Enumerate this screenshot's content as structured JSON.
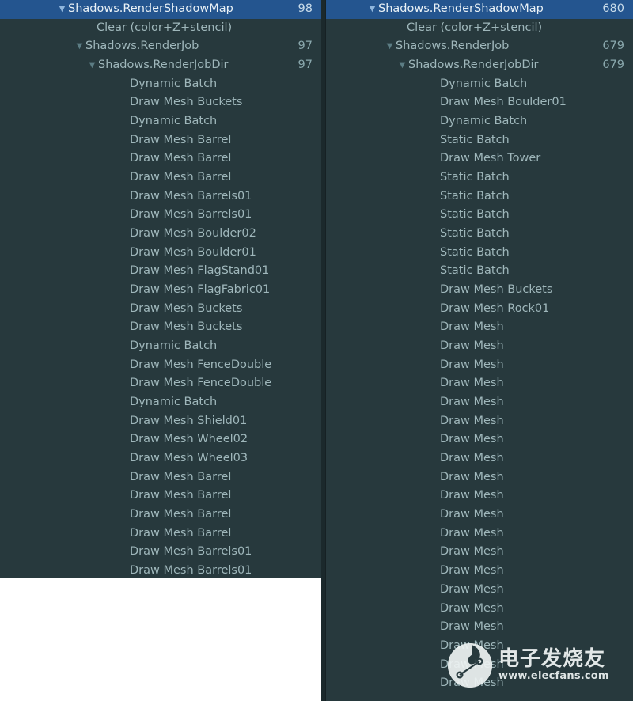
{
  "colors": {
    "panel_background": "#27393d",
    "selection": "#24558f",
    "row_text": "#9fb7bb",
    "selected_text": "#e9f1f6",
    "value_text": "#8aa8ad",
    "divider": "#1b292c",
    "page_background": "#ffffff"
  },
  "left_panel": {
    "name": "profiler-hierarchy-left",
    "rows": [
      {
        "label": "Shadows.RenderShadowMap",
        "value": "98",
        "depth": 0,
        "arrow": "▼",
        "selected": true
      },
      {
        "label": "Clear (color+Z+stencil)",
        "value": "",
        "depth": 1,
        "arrow": "",
        "selected": false
      },
      {
        "label": "Shadows.RenderJob",
        "value": "97",
        "depth": 2,
        "arrow": "▼",
        "selected": false
      },
      {
        "label": "Shadows.RenderJobDir",
        "value": "97",
        "depth": 3,
        "arrow": "▼",
        "selected": false
      },
      {
        "label": "Dynamic Batch",
        "value": "",
        "depth": 4,
        "arrow": "",
        "selected": false
      },
      {
        "label": "Draw Mesh Buckets",
        "value": "",
        "depth": 4,
        "arrow": "",
        "selected": false
      },
      {
        "label": "Dynamic Batch",
        "value": "",
        "depth": 4,
        "arrow": "",
        "selected": false
      },
      {
        "label": "Draw Mesh Barrel",
        "value": "",
        "depth": 4,
        "arrow": "",
        "selected": false
      },
      {
        "label": "Draw Mesh Barrel",
        "value": "",
        "depth": 4,
        "arrow": "",
        "selected": false
      },
      {
        "label": "Draw Mesh Barrel",
        "value": "",
        "depth": 4,
        "arrow": "",
        "selected": false
      },
      {
        "label": "Draw Mesh Barrels01",
        "value": "",
        "depth": 4,
        "arrow": "",
        "selected": false
      },
      {
        "label": "Draw Mesh Barrels01",
        "value": "",
        "depth": 4,
        "arrow": "",
        "selected": false
      },
      {
        "label": "Draw Mesh Boulder02",
        "value": "",
        "depth": 4,
        "arrow": "",
        "selected": false
      },
      {
        "label": "Draw Mesh Boulder01",
        "value": "",
        "depth": 4,
        "arrow": "",
        "selected": false
      },
      {
        "label": "Draw Mesh FlagStand01",
        "value": "",
        "depth": 4,
        "arrow": "",
        "selected": false
      },
      {
        "label": "Draw Mesh FlagFabric01",
        "value": "",
        "depth": 4,
        "arrow": "",
        "selected": false
      },
      {
        "label": "Draw Mesh Buckets",
        "value": "",
        "depth": 4,
        "arrow": "",
        "selected": false
      },
      {
        "label": "Draw Mesh Buckets",
        "value": "",
        "depth": 4,
        "arrow": "",
        "selected": false
      },
      {
        "label": "Dynamic Batch",
        "value": "",
        "depth": 4,
        "arrow": "",
        "selected": false
      },
      {
        "label": "Draw Mesh FenceDouble",
        "value": "",
        "depth": 4,
        "arrow": "",
        "selected": false
      },
      {
        "label": "Draw Mesh FenceDouble",
        "value": "",
        "depth": 4,
        "arrow": "",
        "selected": false
      },
      {
        "label": "Dynamic Batch",
        "value": "",
        "depth": 4,
        "arrow": "",
        "selected": false
      },
      {
        "label": "Draw Mesh Shield01",
        "value": "",
        "depth": 4,
        "arrow": "",
        "selected": false
      },
      {
        "label": "Draw Mesh Wheel02",
        "value": "",
        "depth": 4,
        "arrow": "",
        "selected": false
      },
      {
        "label": "Draw Mesh Wheel03",
        "value": "",
        "depth": 4,
        "arrow": "",
        "selected": false
      },
      {
        "label": "Draw Mesh Barrel",
        "value": "",
        "depth": 4,
        "arrow": "",
        "selected": false
      },
      {
        "label": "Draw Mesh Barrel",
        "value": "",
        "depth": 4,
        "arrow": "",
        "selected": false
      },
      {
        "label": "Draw Mesh Barrel",
        "value": "",
        "depth": 4,
        "arrow": "",
        "selected": false
      },
      {
        "label": "Draw Mesh Barrel",
        "value": "",
        "depth": 4,
        "arrow": "",
        "selected": false
      },
      {
        "label": "Draw Mesh Barrels01",
        "value": "",
        "depth": 4,
        "arrow": "",
        "selected": false
      },
      {
        "label": "Draw Mesh Barrels01",
        "value": "",
        "depth": 4,
        "arrow": "",
        "selected": false
      }
    ]
  },
  "right_panel": {
    "name": "profiler-hierarchy-right",
    "rows": [
      {
        "label": "Shadows.RenderShadowMap",
        "value": "680",
        "depth": 0,
        "arrow": "▼",
        "selected": true
      },
      {
        "label": "Clear (color+Z+stencil)",
        "value": "",
        "depth": 1,
        "arrow": "",
        "selected": false
      },
      {
        "label": "Shadows.RenderJob",
        "value": "679",
        "depth": 2,
        "arrow": "▼",
        "selected": false
      },
      {
        "label": "Shadows.RenderJobDir",
        "value": "679",
        "depth": 3,
        "arrow": "▼",
        "selected": false
      },
      {
        "label": "Dynamic Batch",
        "value": "",
        "depth": 4,
        "arrow": "",
        "selected": false
      },
      {
        "label": "Draw Mesh Boulder01",
        "value": "",
        "depth": 4,
        "arrow": "",
        "selected": false
      },
      {
        "label": "Dynamic Batch",
        "value": "",
        "depth": 4,
        "arrow": "",
        "selected": false
      },
      {
        "label": "Static Batch",
        "value": "",
        "depth": 4,
        "arrow": "",
        "selected": false
      },
      {
        "label": "Draw Mesh Tower",
        "value": "",
        "depth": 4,
        "arrow": "",
        "selected": false
      },
      {
        "label": "Static Batch",
        "value": "",
        "depth": 4,
        "arrow": "",
        "selected": false
      },
      {
        "label": "Static Batch",
        "value": "",
        "depth": 4,
        "arrow": "",
        "selected": false
      },
      {
        "label": "Static Batch",
        "value": "",
        "depth": 4,
        "arrow": "",
        "selected": false
      },
      {
        "label": "Static Batch",
        "value": "",
        "depth": 4,
        "arrow": "",
        "selected": false
      },
      {
        "label": "Static Batch",
        "value": "",
        "depth": 4,
        "arrow": "",
        "selected": false
      },
      {
        "label": "Static Batch",
        "value": "",
        "depth": 4,
        "arrow": "",
        "selected": false
      },
      {
        "label": "Draw Mesh Buckets",
        "value": "",
        "depth": 4,
        "arrow": "",
        "selected": false
      },
      {
        "label": "Draw Mesh Rock01",
        "value": "",
        "depth": 4,
        "arrow": "",
        "selected": false
      },
      {
        "label": "Draw Mesh",
        "value": "",
        "depth": 4,
        "arrow": "",
        "selected": false
      },
      {
        "label": "Draw Mesh",
        "value": "",
        "depth": 4,
        "arrow": "",
        "selected": false
      },
      {
        "label": "Draw Mesh",
        "value": "",
        "depth": 4,
        "arrow": "",
        "selected": false
      },
      {
        "label": "Draw Mesh",
        "value": "",
        "depth": 4,
        "arrow": "",
        "selected": false
      },
      {
        "label": "Draw Mesh",
        "value": "",
        "depth": 4,
        "arrow": "",
        "selected": false
      },
      {
        "label": "Draw Mesh",
        "value": "",
        "depth": 4,
        "arrow": "",
        "selected": false
      },
      {
        "label": "Draw Mesh",
        "value": "",
        "depth": 4,
        "arrow": "",
        "selected": false
      },
      {
        "label": "Draw Mesh",
        "value": "",
        "depth": 4,
        "arrow": "",
        "selected": false
      },
      {
        "label": "Draw Mesh",
        "value": "",
        "depth": 4,
        "arrow": "",
        "selected": false
      },
      {
        "label": "Draw Mesh",
        "value": "",
        "depth": 4,
        "arrow": "",
        "selected": false
      },
      {
        "label": "Draw Mesh",
        "value": "",
        "depth": 4,
        "arrow": "",
        "selected": false
      },
      {
        "label": "Draw Mesh",
        "value": "",
        "depth": 4,
        "arrow": "",
        "selected": false
      },
      {
        "label": "Draw Mesh",
        "value": "",
        "depth": 4,
        "arrow": "",
        "selected": false
      },
      {
        "label": "Draw Mesh",
        "value": "",
        "depth": 4,
        "arrow": "",
        "selected": false
      },
      {
        "label": "Draw Mesh",
        "value": "",
        "depth": 4,
        "arrow": "",
        "selected": false
      },
      {
        "label": "Draw Mesh",
        "value": "",
        "depth": 4,
        "arrow": "",
        "selected": false
      },
      {
        "label": "Draw Mesh",
        "value": "",
        "depth": 4,
        "arrow": "",
        "selected": false
      },
      {
        "label": "Draw Mesh",
        "value": "",
        "depth": 4,
        "arrow": "",
        "selected": false
      },
      {
        "label": "Draw Mesh",
        "value": "",
        "depth": 4,
        "arrow": "",
        "selected": false
      },
      {
        "label": "Draw Mesh",
        "value": "",
        "depth": 4,
        "arrow": "",
        "selected": false
      }
    ]
  },
  "watermark": {
    "chinese": "电子发烧友",
    "url": "www.elecfans.com"
  }
}
